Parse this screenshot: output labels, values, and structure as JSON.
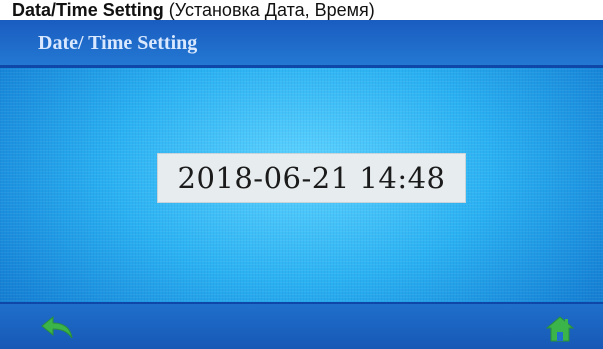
{
  "caption": {
    "bold_text": "Data/Time Setting",
    "rest_text": "(Установка Дата, Время)"
  },
  "window": {
    "title": "Date/ Time Setting"
  },
  "datetime": {
    "value": "2018-06-21 14:48"
  },
  "toolbar": {
    "back_icon": "back-arrow-icon",
    "home_icon": "home-icon"
  },
  "colors": {
    "background": "#2ab1f2",
    "title_bar": "#1a5cc0",
    "icon_green": "#3bb54a",
    "field_bg": "#e7ecef"
  }
}
